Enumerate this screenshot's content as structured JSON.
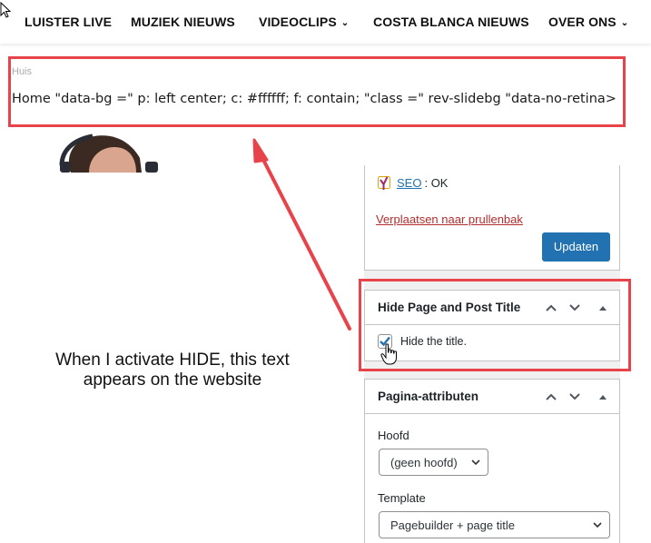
{
  "nav": {
    "items": [
      {
        "label": "LUISTER LIVE",
        "dropdown": false
      },
      {
        "label": "MUZIEK NIEUWS",
        "dropdown": false
      },
      {
        "label": "VIDEOCLIPS",
        "dropdown": true
      },
      {
        "label": "COSTA BLANCA NIEUWS",
        "dropdown": false
      },
      {
        "label": "OVER ONS",
        "dropdown": true
      }
    ]
  },
  "page": {
    "breadcrumb": "Huis",
    "garbled_title": "Home \"data-bg =\" p: left center; c: #ffffff; f: contain; \"class =\" rev-slidebg \"data-no-retina>"
  },
  "publish": {
    "seo_link": "SEO",
    "seo_status": ": OK",
    "trash_link": "Verplaatsen naar prullenbak",
    "update_button": "Updaten"
  },
  "hide_title_box": {
    "title": "Hide Page and Post Title",
    "checkbox_label": "Hide the title.",
    "checked": true
  },
  "page_attributes": {
    "title": "Pagina-attributen",
    "parent_label": "Hoofd",
    "parent_value": "(geen hoofd)",
    "template_label": "Template",
    "template_value": "Pagebuilder + page title"
  },
  "annotation": {
    "caption": "When I activate HIDE, this text appears on the website",
    "color": "#e8434b"
  },
  "colors": {
    "primary_button": "#2271b1",
    "trash_link": "#b32d2e",
    "admin_bg": "#f0f0f1"
  }
}
